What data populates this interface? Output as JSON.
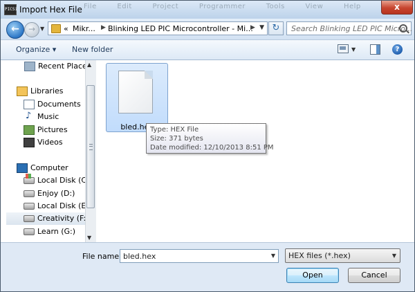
{
  "window": {
    "title": "Import Hex File",
    "app_icon_text": "PICSi",
    "background_menu": "File  Edit  Project  Programmer  Tools  View  Help",
    "close_label": "x"
  },
  "address_bar": {
    "overflow": "«",
    "crumbs": [
      "Mikr...",
      "Blinking LED PIC Microcontroller - Mi..."
    ]
  },
  "search": {
    "placeholder": "Search Blinking LED PIC Micro..."
  },
  "toolbar": {
    "organize_label": "Organize ▾",
    "new_folder_label": "New folder"
  },
  "nav": {
    "items": [
      {
        "label": "Recent Places",
        "icon": "recent-places-icon"
      },
      {
        "label": "Libraries",
        "icon": "libraries-icon"
      },
      {
        "label": "Documents",
        "icon": "documents-icon"
      },
      {
        "label": "Music",
        "icon": "music-icon"
      },
      {
        "label": "Pictures",
        "icon": "pictures-icon"
      },
      {
        "label": "Videos",
        "icon": "videos-icon"
      },
      {
        "label": "Computer",
        "icon": "computer-icon"
      },
      {
        "label": "Local Disk (C:)",
        "icon": "system-disk-icon"
      },
      {
        "label": "Enjoy (D:)",
        "icon": "disk-icon"
      },
      {
        "label": "Local Disk (E:)",
        "icon": "disk-icon"
      },
      {
        "label": "Creativity (F:)",
        "icon": "disk-icon",
        "selected": true
      },
      {
        "label": "Learn (G:)",
        "icon": "disk-icon"
      }
    ]
  },
  "files": [
    {
      "name": "bled.hex",
      "icon": "blank-file-icon",
      "selected": true
    }
  ],
  "tooltip": {
    "type": "Type: HEX File",
    "size": "Size: 371 bytes",
    "modified": "Date modified: 12/10/2013 8:51 PM"
  },
  "footer": {
    "file_name_label": "File name:",
    "file_name_value": "bled.hex",
    "filter_value": "HEX files (*.hex)",
    "open_label": "Open",
    "cancel_label": "Cancel"
  }
}
